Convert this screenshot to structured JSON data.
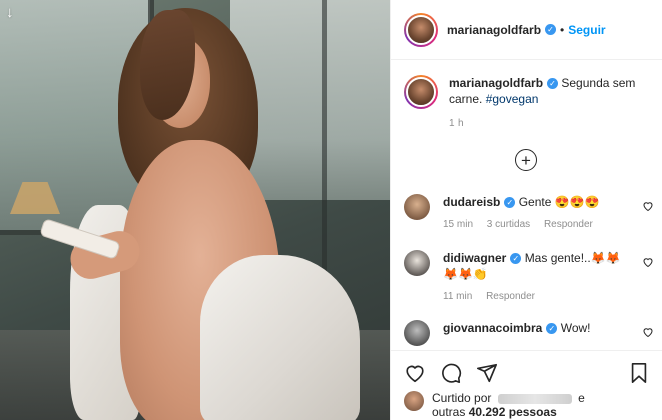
{
  "photo": {
    "back_arrow": "↓"
  },
  "header": {
    "username": "marianagoldfarb",
    "separator": "•",
    "follow_label": "Seguir"
  },
  "caption": {
    "username": "marianagoldfarb",
    "text": "Segunda sem carne.",
    "hashtag": "#govegan",
    "time": "1 h"
  },
  "load_more_icon": "+",
  "comments": [
    {
      "username": "dudareisb",
      "text": "Gente 😍😍😍",
      "time": "15 min",
      "likes": "3 curtidas",
      "reply": "Responder"
    },
    {
      "username": "didiwagner",
      "text": "Mas gente!..🦊🦊 🦊🦊👏",
      "time": "11 min",
      "reply": "Responder"
    },
    {
      "username": "giovannacoimbra",
      "text": "Wow!"
    }
  ],
  "likes": {
    "prefix": "Curtido por",
    "suffix": "e",
    "others_prefix": "outras",
    "count": "40.292",
    "others_suffix": "pessoas"
  },
  "colors": {
    "accent": "#0095f6",
    "verified": "#3897f0",
    "text": "#262626",
    "muted": "#8e8e8e"
  }
}
